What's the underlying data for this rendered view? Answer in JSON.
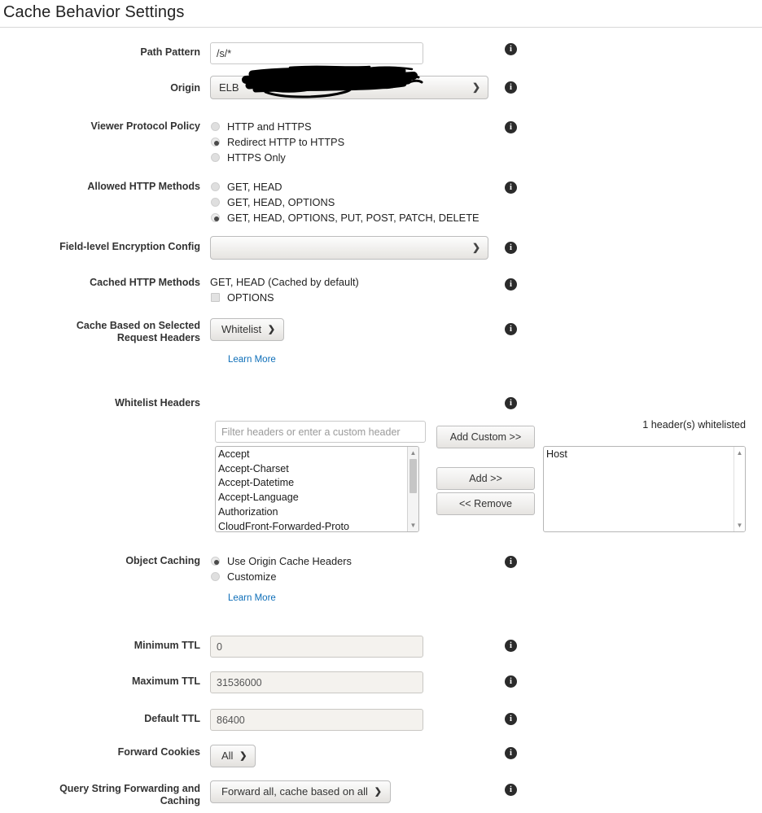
{
  "page": {
    "title": "Cache Behavior Settings"
  },
  "icons": {
    "info": "info-icon",
    "chevron_down": "⌄"
  },
  "fields": {
    "path_pattern": {
      "label": "Path Pattern",
      "value": "/s/*"
    },
    "origin": {
      "label": "Origin",
      "value": "ELB",
      "redacted": true
    },
    "viewer_protocol_policy": {
      "label": "Viewer Protocol Policy",
      "options": [
        {
          "label": "HTTP and HTTPS",
          "selected": false
        },
        {
          "label": "Redirect HTTP to HTTPS",
          "selected": true
        },
        {
          "label": "HTTPS Only",
          "selected": false
        }
      ]
    },
    "allowed_http_methods": {
      "label": "Allowed HTTP Methods",
      "options": [
        {
          "label": "GET, HEAD",
          "selected": false
        },
        {
          "label": "GET, HEAD, OPTIONS",
          "selected": false
        },
        {
          "label": "GET, HEAD, OPTIONS, PUT, POST, PATCH, DELETE",
          "selected": true
        }
      ]
    },
    "field_level_encryption_config": {
      "label": "Field-level Encryption Config",
      "value": ""
    },
    "cached_http_methods": {
      "label": "Cached HTTP Methods",
      "static_text": "GET, HEAD (Cached by default)",
      "checkbox_label": "OPTIONS",
      "checkbox_checked": false
    },
    "cache_based_on_selected_request_headers": {
      "label_line1": "Cache Based on Selected",
      "label_line2": "Request Headers",
      "value": "Whitelist",
      "learn_more": "Learn More"
    },
    "whitelist_headers": {
      "label": "Whitelist Headers",
      "filter_placeholder": "Filter headers or enter a custom header",
      "filter_value": "",
      "add_custom_button": "Add Custom >>",
      "add_button": "Add >>",
      "remove_button": "<< Remove",
      "count_text": "1 header(s) whitelisted",
      "available": [
        "Accept",
        "Accept-Charset",
        "Accept-Datetime",
        "Accept-Language",
        "Authorization",
        "CloudFront-Forwarded-Proto"
      ],
      "selected": [
        "Host"
      ]
    },
    "object_caching": {
      "label": "Object Caching",
      "options": [
        {
          "label": "Use Origin Cache Headers",
          "selected": true
        },
        {
          "label": "Customize",
          "selected": false
        }
      ],
      "learn_more": "Learn More"
    },
    "minimum_ttl": {
      "label": "Minimum TTL",
      "value": "0"
    },
    "maximum_ttl": {
      "label": "Maximum TTL",
      "value": "31536000"
    },
    "default_ttl": {
      "label": "Default TTL",
      "value": "86400"
    },
    "forward_cookies": {
      "label": "Forward Cookies",
      "value": "All"
    },
    "query_string_forwarding": {
      "label_line1": "Query String Forwarding and",
      "label_line2": "Caching",
      "value": "Forward all, cache based on all"
    }
  },
  "colors": {
    "link": "#0d6eb8",
    "text": "#222222",
    "border": "#bdbdbd",
    "readonly_bg": "#f4f2ee"
  }
}
